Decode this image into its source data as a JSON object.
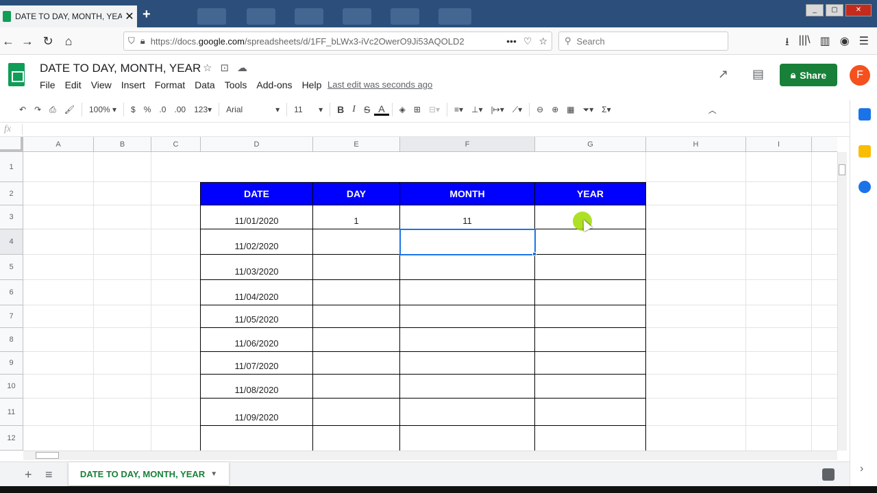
{
  "browser": {
    "tab_title": "DATE TO DAY, MONTH, YEAR",
    "url_prefix": "https://docs.",
    "url_domain": "google.com",
    "url_path": "/spreadsheets/d/1FF_bLWx3-iVc2OwerO9Ji53AQOLD2",
    "search_placeholder": "Search"
  },
  "doc": {
    "title": "DATE TO DAY, MONTH, YEAR",
    "menu": [
      "File",
      "Edit",
      "View",
      "Insert",
      "Format",
      "Data",
      "Tools",
      "Add-ons",
      "Help"
    ],
    "last_edit": "Last edit was seconds ago",
    "share_label": "Share",
    "avatar_letter": "F"
  },
  "toolbar": {
    "zoom": "100%",
    "currency": "$",
    "percent": "%",
    "dec_decrease": ".0",
    "dec_increase": ".00",
    "format_more": "123",
    "font": "Arial",
    "font_size": "11",
    "bold": "B",
    "italic": "I",
    "strike": "S",
    "text_color": "A"
  },
  "formula_bar": {
    "fx": "fx"
  },
  "grid": {
    "columns": [
      "A",
      "B",
      "C",
      "D",
      "E",
      "F",
      "G",
      "H",
      "I"
    ],
    "rows": [
      "1",
      "2",
      "3",
      "4",
      "5",
      "6",
      "7",
      "8",
      "9",
      "10",
      "11",
      "12"
    ],
    "header_color": "#0000ff",
    "selection_color": "#1a73e8"
  },
  "table": {
    "headers": [
      "DATE",
      "DAY",
      "MONTH",
      "YEAR"
    ],
    "rows": [
      [
        "11/01/2020",
        "1",
        "11",
        ""
      ],
      [
        "11/02/2020",
        "",
        "",
        ""
      ],
      [
        "11/03/2020",
        "",
        "",
        ""
      ],
      [
        "11/04/2020",
        "",
        "",
        ""
      ],
      [
        "11/05/2020",
        "",
        "",
        ""
      ],
      [
        "11/06/2020",
        "",
        "",
        ""
      ],
      [
        "11/07/2020",
        "",
        "",
        ""
      ],
      [
        "11/08/2020",
        "",
        "",
        ""
      ],
      [
        "11/09/2020",
        "",
        "",
        ""
      ],
      [
        "",
        "",
        "",
        ""
      ]
    ]
  },
  "sheet_tabs": {
    "active": "DATE TO DAY, MONTH, YEAR"
  },
  "colors": {
    "share_green": "#188038",
    "avatar_orange": "#f4511e"
  }
}
